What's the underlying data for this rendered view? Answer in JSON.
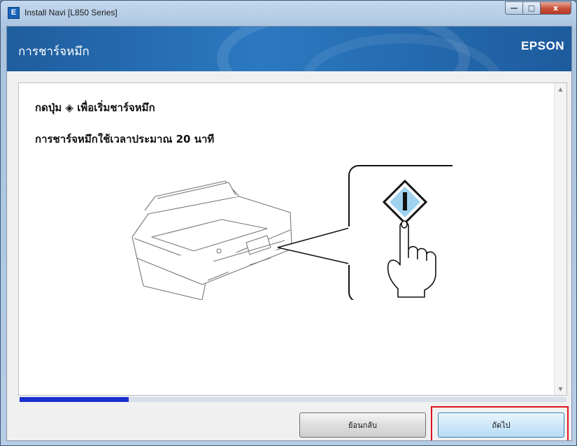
{
  "window": {
    "title": "Install Navi [L850 Series]",
    "app_icon_glyph": "E",
    "controls": {
      "minimize": "—",
      "maximize": "□",
      "close": "x"
    }
  },
  "banner": {
    "title": "การชาร์จหมึก",
    "brand": "EPSON"
  },
  "content": {
    "instruction_before_icon": "กดปุ่ม",
    "start_icon_glyph": "◈",
    "instruction_after_icon": "เพื่อเริ่มชาร์จหมึก",
    "duration_text": "การชาร์จหมึกใช้เวลาประมาณ 20 นาที",
    "illustration_icons": [
      "printer-icon",
      "start-button-icon",
      "pressing-hand-icon"
    ]
  },
  "scrollbar": {
    "up": "▲",
    "down": "▼"
  },
  "progress": {
    "fraction": 0.2
  },
  "buttons": {
    "back_label": "ย้อนกลับ",
    "next_label": "ถัดไป"
  },
  "colors": {
    "banner": "#2c79c1",
    "progress": "#1c2ecf",
    "highlight": "#e0151c"
  }
}
